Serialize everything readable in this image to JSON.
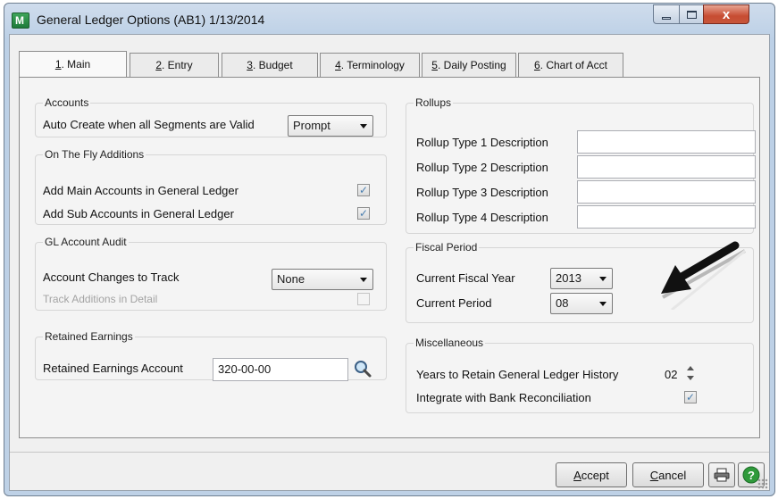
{
  "window": {
    "title": "General Ledger Options (AB1) 1/13/2014",
    "close_glyph": "x"
  },
  "tabs": [
    {
      "key": "1",
      "label": ". Main"
    },
    {
      "key": "2",
      "label": ". Entry"
    },
    {
      "key": "3",
      "label": ". Budget"
    },
    {
      "key": "4",
      "label": ". Terminology"
    },
    {
      "key": "5",
      "label": ". Daily Posting"
    },
    {
      "key": "6",
      "label": ". Chart of Acct"
    }
  ],
  "accounts": {
    "legend": "Accounts",
    "auto_create_label": "Auto Create when all Segments are Valid",
    "auto_create_value": "Prompt"
  },
  "on_the_fly": {
    "legend": "On The Fly Additions",
    "add_main_label": "Add Main Accounts in General Ledger",
    "add_main_checked": true,
    "add_sub_label": "Add Sub Accounts in General Ledger",
    "add_sub_checked": true
  },
  "audit": {
    "legend": "GL Account Audit",
    "changes_label": "Account Changes to Track",
    "changes_value": "None",
    "additions_label": "Track Additions in Detail",
    "additions_checked": false
  },
  "retained": {
    "legend": "Retained Earnings",
    "account_label": "Retained Earnings Account",
    "account_value": "320-00-00"
  },
  "rollups": {
    "legend": "Rollups",
    "items": [
      {
        "label": "Rollup Type 1 Description",
        "value": ""
      },
      {
        "label": "Rollup Type 2 Description",
        "value": ""
      },
      {
        "label": "Rollup Type 3 Description",
        "value": ""
      },
      {
        "label": "Rollup Type 4 Description",
        "value": ""
      }
    ]
  },
  "fiscal": {
    "legend": "Fiscal Period",
    "year_label": "Current Fiscal Year",
    "year_value": "2013",
    "period_label": "Current Period",
    "period_value": "08"
  },
  "misc": {
    "legend": "Miscellaneous",
    "history_label": "Years to Retain General Ledger History",
    "history_value": "02",
    "bank_label": "Integrate with Bank Reconciliation",
    "bank_checked": true
  },
  "footer": {
    "accept_key": "A",
    "accept_rest": "ccept",
    "cancel_key": "C",
    "cancel_rest": "ancel"
  },
  "icons": {
    "lookup": "magnifier-icon",
    "print": "printer-icon",
    "help": "help-icon",
    "annotation": "black-arrow-annotation"
  },
  "colors": {
    "help_green": "#2f9a3b",
    "check_blue": "#4a7fb0"
  }
}
